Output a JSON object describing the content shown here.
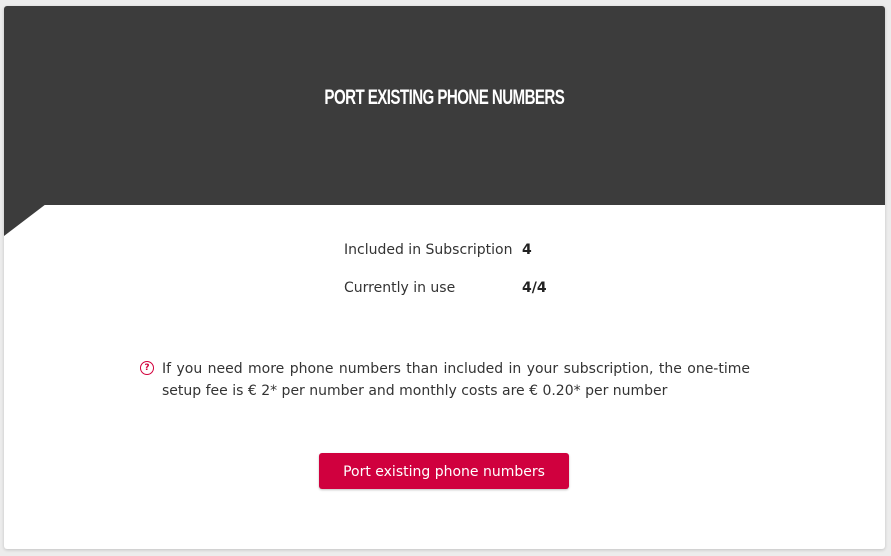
{
  "header": {
    "title": "Port existing phone numbers"
  },
  "stats": [
    {
      "label": "Included in Subscription",
      "value": "4"
    },
    {
      "label": "Currently in use",
      "value": "4/4"
    }
  ],
  "info": {
    "icon": "question-circle-icon",
    "text": "If you need more phone numbers than included in your subscription, the one-time setup fee is € 2* per number and monthly costs are € 0.20* per number"
  },
  "action": {
    "button_label": "Port existing phone numbers"
  },
  "colors": {
    "header_bg": "#3c3c3c",
    "accent": "#d0003e",
    "page_bg": "#ececec",
    "card_bg": "#ffffff"
  }
}
